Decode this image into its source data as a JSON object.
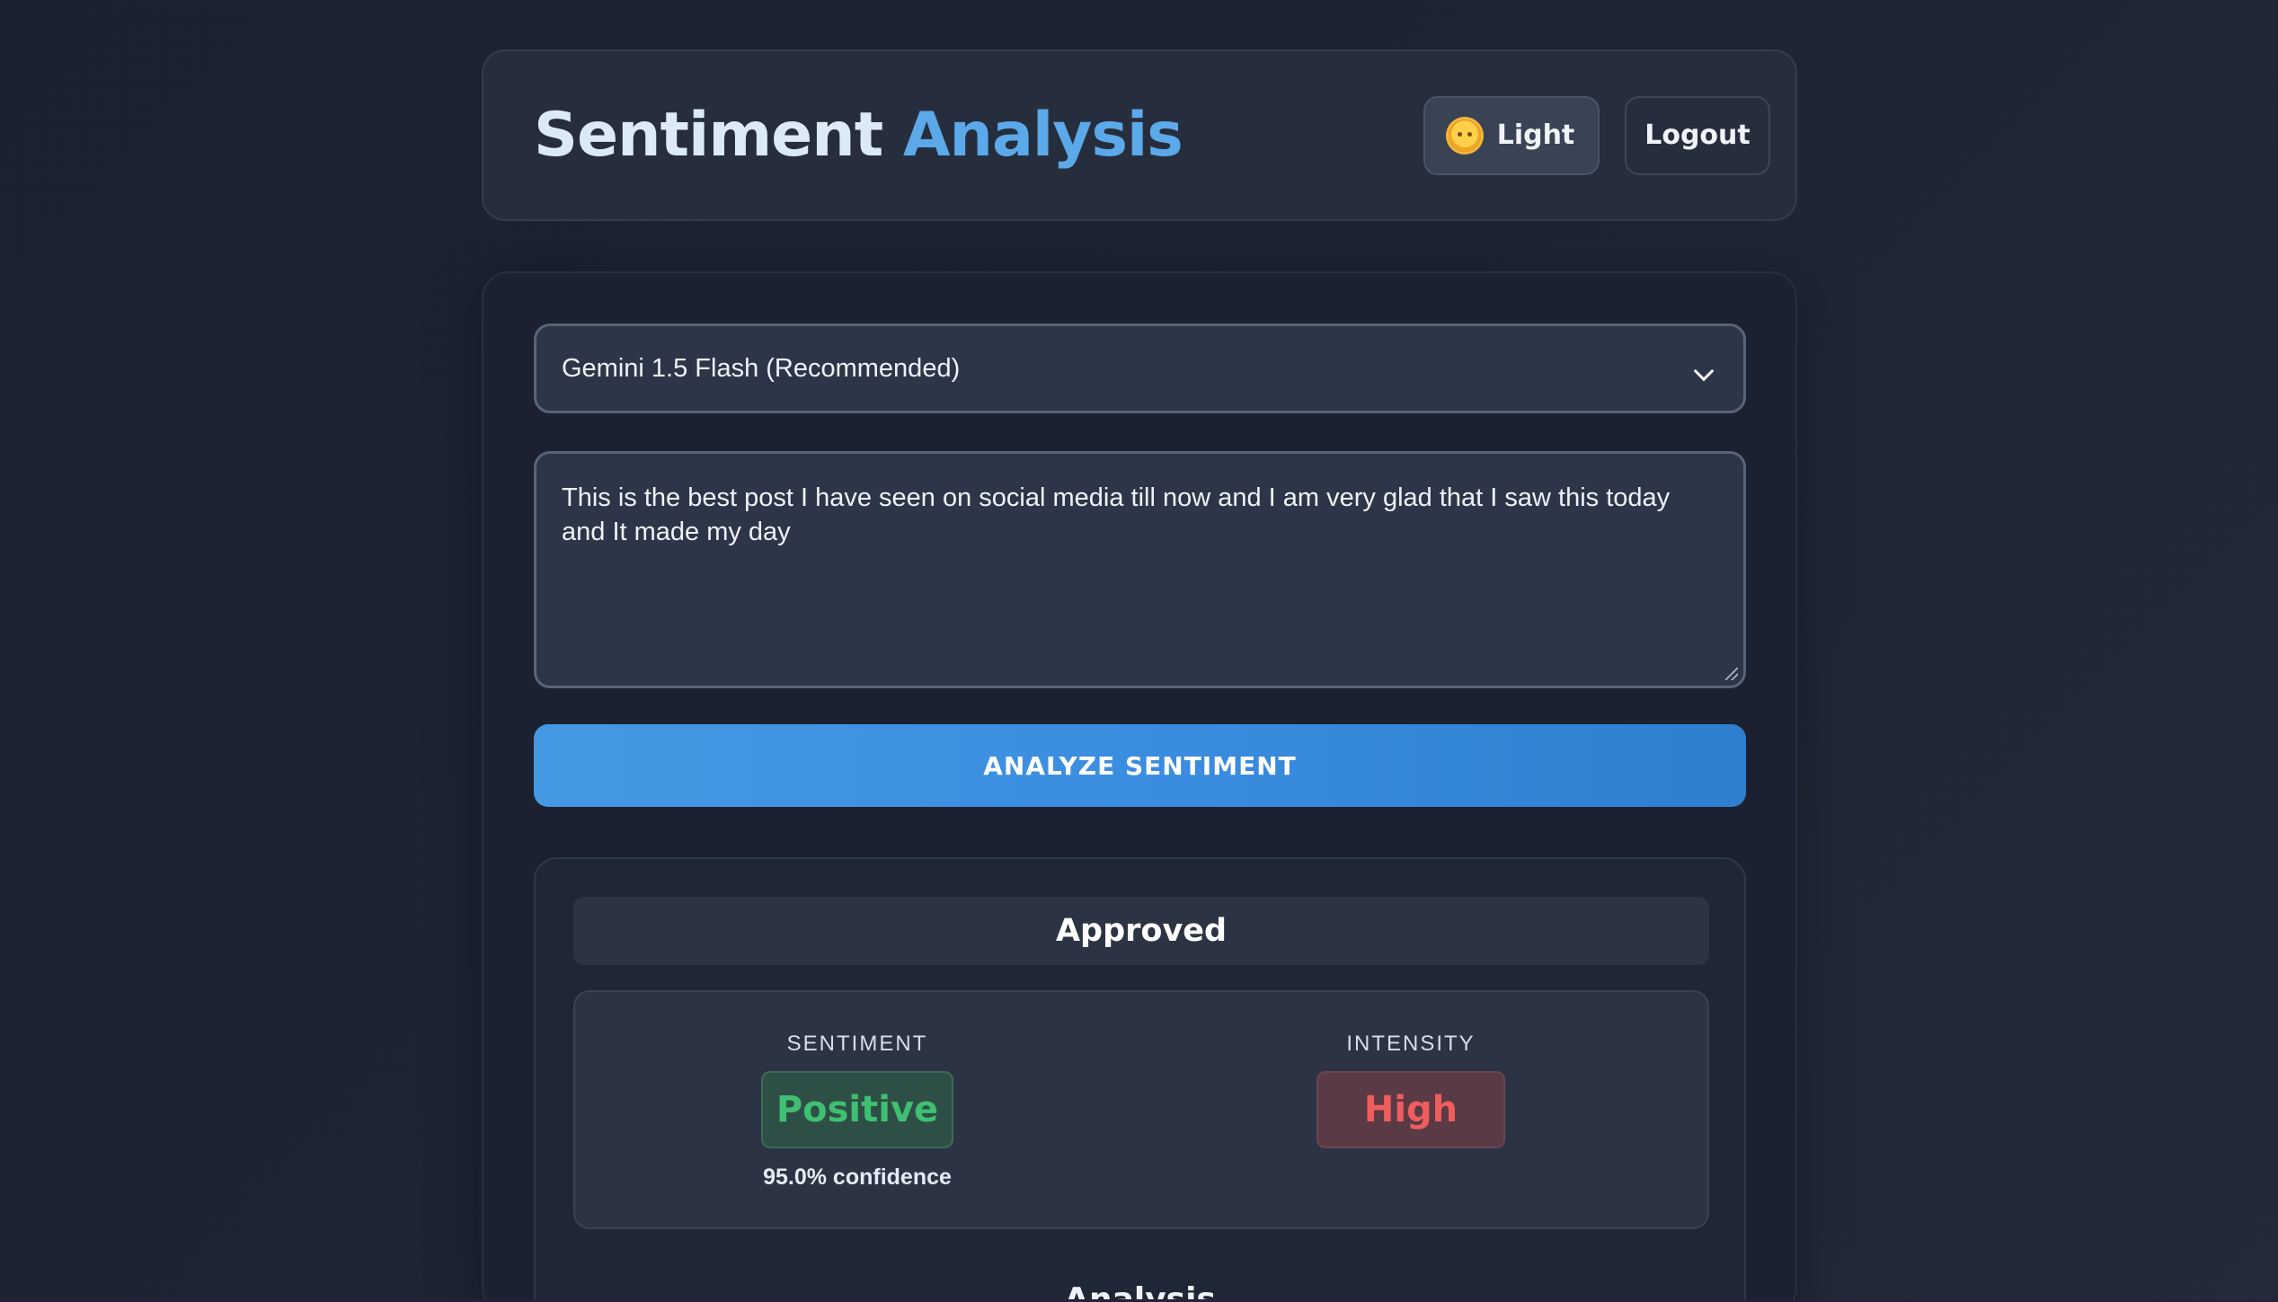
{
  "header": {
    "title_part1": "Sentiment",
    "title_part2": "Analysis",
    "theme_button_label": "Light",
    "theme_icon": "sun-emoji-icon",
    "logout_label": "Logout"
  },
  "form": {
    "model_select_value": "Gemini 1.5 Flash (Recommended)",
    "input_text": "This is the best post I have seen on social media till now and I am very glad that I saw this today and It made my day",
    "analyze_button_label": "ANALYZE SENTIMENT"
  },
  "result": {
    "status": "Approved",
    "sentiment_label": "SENTIMENT",
    "sentiment_value": "Positive",
    "confidence": "95.0% confidence",
    "intensity_label": "INTENSITY",
    "intensity_value": "High",
    "analysis_heading": "Analysis"
  },
  "colors": {
    "accent": "#3a8de0",
    "positive": "#3fbf72",
    "high": "#ef5d5d",
    "title_highlight": "#5ca9ea"
  }
}
